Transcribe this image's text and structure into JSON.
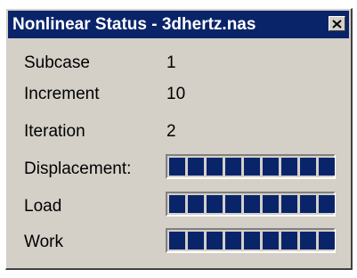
{
  "window": {
    "title": "Nonlinear Status - 3dhertz.nas"
  },
  "fields": [
    {
      "label": "Subcase",
      "value": "1"
    },
    {
      "label": "Increment",
      "value": "10"
    },
    {
      "label": "Iteration",
      "value": "2"
    }
  ],
  "progress": [
    {
      "label": "Displacement:",
      "fraction": 1.0
    },
    {
      "label": "Load",
      "fraction": 1.0
    },
    {
      "label": "Work",
      "fraction": 1.0
    }
  ],
  "colors": {
    "titlebar": "#0a246a",
    "progress_fill": "#0a246a",
    "dialog_bg": "#d4d0c8"
  },
  "icons": {
    "close": "close-icon"
  }
}
